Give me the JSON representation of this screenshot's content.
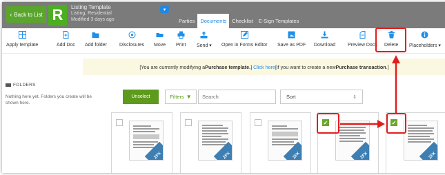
{
  "header": {
    "back_label": "Back to List",
    "logo_letter": "R",
    "template_name": "Listing Template",
    "template_type": "Listing, Residential",
    "modified": "Modified 3 days ago",
    "tabs": [
      {
        "label": "Parties",
        "active": false
      },
      {
        "label": "Documents",
        "active": true
      },
      {
        "label": "Checklist",
        "active": false
      },
      {
        "label": "E-Sign Templates",
        "active": false
      }
    ]
  },
  "toolbar": {
    "items": [
      {
        "label": "Apply template",
        "icon": "grid-icon"
      },
      {
        "label": "Add Doc",
        "icon": "add-doc-icon"
      },
      {
        "label": "Add folder",
        "icon": "add-folder-icon"
      },
      {
        "label": "Disclosures",
        "icon": "disclosures-icon"
      },
      {
        "label": "Move",
        "icon": "move-icon"
      },
      {
        "label": "Print",
        "icon": "print-icon"
      },
      {
        "label": "Send ▾",
        "icon": "send-icon"
      },
      {
        "label": "Open in Forms Editor",
        "icon": "edit-icon"
      },
      {
        "label": "Save as PDF",
        "icon": "pdf-icon"
      },
      {
        "label": "Download",
        "icon": "download-icon"
      },
      {
        "label": "Preview Docs",
        "icon": "preview-icon"
      },
      {
        "label": "Delete",
        "icon": "trash-icon"
      },
      {
        "label": "Placeholders ▾",
        "icon": "info-icon"
      }
    ]
  },
  "notice": {
    "pre": "[You are currently modifying a ",
    "bold1": "Purchase template.",
    "mid": "] ",
    "link": "Click here",
    "post": " [if you want to create a new ",
    "bold2": "Purchase transaction",
    "end": ".]"
  },
  "folders": {
    "title": "FOLDERS",
    "empty_text": "Nothing here yet. Folders you create will be shown here."
  },
  "controls": {
    "unselect_label": "Unselect",
    "filters_label": "Filters",
    "search_placeholder": "Search",
    "sort_label": "Sort"
  },
  "documents": [
    {
      "checked": false,
      "tag": "ZFX"
    },
    {
      "checked": false,
      "tag": "ZFX"
    },
    {
      "checked": false,
      "tag": "ZFX"
    },
    {
      "checked": true,
      "tag": "ZFX"
    },
    {
      "checked": true,
      "tag": "ZFX"
    }
  ],
  "colors": {
    "header_bg": "#7b7b7b",
    "brand_green": "#4caf1f",
    "accent_blue": "#1e88e5",
    "highlight_red": "#e21d1d"
  }
}
